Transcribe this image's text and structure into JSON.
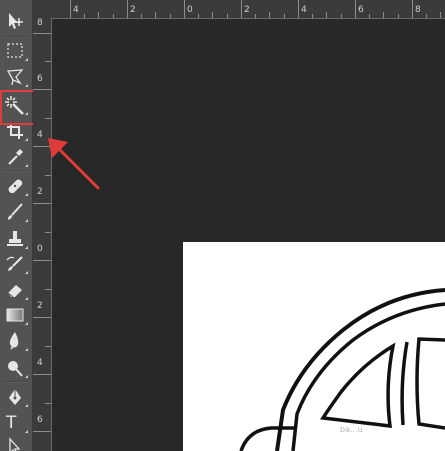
{
  "ruler_top": {
    "labels": [
      "4",
      "2",
      "0",
      "2",
      "4",
      "6",
      "8"
    ]
  },
  "ruler_left": {
    "labels": [
      "8",
      "6",
      "4",
      "2",
      "0",
      "2",
      "4",
      "6"
    ]
  },
  "tools": [
    {
      "name": "move-tool",
      "icon": "move-icon"
    },
    {
      "name": "marquee-tool",
      "icon": "rectangle-marquee-icon"
    },
    {
      "name": "lasso-tool",
      "icon": "polygonal-lasso-icon"
    },
    {
      "name": "magic-wand-tool",
      "icon": "magic-wand-icon"
    },
    {
      "name": "crop-tool",
      "icon": "crop-icon"
    },
    {
      "name": "eyedropper-tool",
      "icon": "eyedropper-icon"
    },
    {
      "name": "healing-brush-tool",
      "icon": "bandage-icon"
    },
    {
      "name": "brush-tool",
      "icon": "brush-icon"
    },
    {
      "name": "clone-stamp-tool",
      "icon": "stamp-icon"
    },
    {
      "name": "history-brush-tool",
      "icon": "history-brush-icon"
    },
    {
      "name": "eraser-tool",
      "icon": "eraser-icon"
    },
    {
      "name": "gradient-tool",
      "icon": "gradient-icon"
    },
    {
      "name": "blur-tool",
      "icon": "blur-drop-icon"
    },
    {
      "name": "dodge-tool",
      "icon": "dodge-icon"
    },
    {
      "name": "pen-tool",
      "icon": "pen-icon"
    },
    {
      "name": "type-tool",
      "icon": "type-icon",
      "label": "T"
    },
    {
      "name": "path-selection-tool",
      "icon": "path-selection-icon"
    }
  ],
  "selected_tool": "magic-wand-tool",
  "colors": {
    "highlight": "#e23b3b",
    "pasteboard": "#282828",
    "panel": "#535353"
  },
  "watermark": "ba...u"
}
